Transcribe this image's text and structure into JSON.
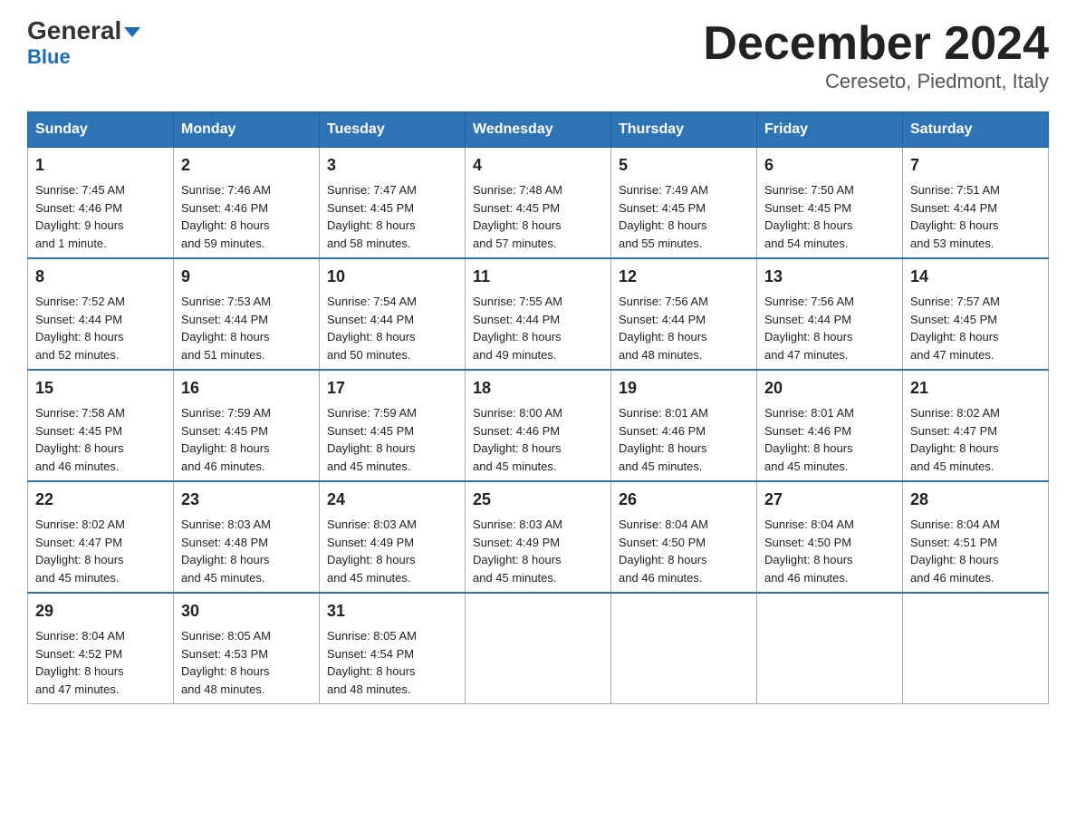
{
  "logo": {
    "general": "General",
    "blue": "Blue",
    "arrow": "▼"
  },
  "header": {
    "month_year": "December 2024",
    "location": "Cereseto, Piedmont, Italy"
  },
  "weekdays": [
    "Sunday",
    "Monday",
    "Tuesday",
    "Wednesday",
    "Thursday",
    "Friday",
    "Saturday"
  ],
  "weeks": [
    [
      {
        "day": "1",
        "sunrise": "7:45 AM",
        "sunset": "4:46 PM",
        "daylight": "9 hours and 1 minute."
      },
      {
        "day": "2",
        "sunrise": "7:46 AM",
        "sunset": "4:46 PM",
        "daylight": "8 hours and 59 minutes."
      },
      {
        "day": "3",
        "sunrise": "7:47 AM",
        "sunset": "4:45 PM",
        "daylight": "8 hours and 58 minutes."
      },
      {
        "day": "4",
        "sunrise": "7:48 AM",
        "sunset": "4:45 PM",
        "daylight": "8 hours and 57 minutes."
      },
      {
        "day": "5",
        "sunrise": "7:49 AM",
        "sunset": "4:45 PM",
        "daylight": "8 hours and 55 minutes."
      },
      {
        "day": "6",
        "sunrise": "7:50 AM",
        "sunset": "4:45 PM",
        "daylight": "8 hours and 54 minutes."
      },
      {
        "day": "7",
        "sunrise": "7:51 AM",
        "sunset": "4:44 PM",
        "daylight": "8 hours and 53 minutes."
      }
    ],
    [
      {
        "day": "8",
        "sunrise": "7:52 AM",
        "sunset": "4:44 PM",
        "daylight": "8 hours and 52 minutes."
      },
      {
        "day": "9",
        "sunrise": "7:53 AM",
        "sunset": "4:44 PM",
        "daylight": "8 hours and 51 minutes."
      },
      {
        "day": "10",
        "sunrise": "7:54 AM",
        "sunset": "4:44 PM",
        "daylight": "8 hours and 50 minutes."
      },
      {
        "day": "11",
        "sunrise": "7:55 AM",
        "sunset": "4:44 PM",
        "daylight": "8 hours and 49 minutes."
      },
      {
        "day": "12",
        "sunrise": "7:56 AM",
        "sunset": "4:44 PM",
        "daylight": "8 hours and 48 minutes."
      },
      {
        "day": "13",
        "sunrise": "7:56 AM",
        "sunset": "4:44 PM",
        "daylight": "8 hours and 47 minutes."
      },
      {
        "day": "14",
        "sunrise": "7:57 AM",
        "sunset": "4:45 PM",
        "daylight": "8 hours and 47 minutes."
      }
    ],
    [
      {
        "day": "15",
        "sunrise": "7:58 AM",
        "sunset": "4:45 PM",
        "daylight": "8 hours and 46 minutes."
      },
      {
        "day": "16",
        "sunrise": "7:59 AM",
        "sunset": "4:45 PM",
        "daylight": "8 hours and 46 minutes."
      },
      {
        "day": "17",
        "sunrise": "7:59 AM",
        "sunset": "4:45 PM",
        "daylight": "8 hours and 45 minutes."
      },
      {
        "day": "18",
        "sunrise": "8:00 AM",
        "sunset": "4:46 PM",
        "daylight": "8 hours and 45 minutes."
      },
      {
        "day": "19",
        "sunrise": "8:01 AM",
        "sunset": "4:46 PM",
        "daylight": "8 hours and 45 minutes."
      },
      {
        "day": "20",
        "sunrise": "8:01 AM",
        "sunset": "4:46 PM",
        "daylight": "8 hours and 45 minutes."
      },
      {
        "day": "21",
        "sunrise": "8:02 AM",
        "sunset": "4:47 PM",
        "daylight": "8 hours and 45 minutes."
      }
    ],
    [
      {
        "day": "22",
        "sunrise": "8:02 AM",
        "sunset": "4:47 PM",
        "daylight": "8 hours and 45 minutes."
      },
      {
        "day": "23",
        "sunrise": "8:03 AM",
        "sunset": "4:48 PM",
        "daylight": "8 hours and 45 minutes."
      },
      {
        "day": "24",
        "sunrise": "8:03 AM",
        "sunset": "4:49 PM",
        "daylight": "8 hours and 45 minutes."
      },
      {
        "day": "25",
        "sunrise": "8:03 AM",
        "sunset": "4:49 PM",
        "daylight": "8 hours and 45 minutes."
      },
      {
        "day": "26",
        "sunrise": "8:04 AM",
        "sunset": "4:50 PM",
        "daylight": "8 hours and 46 minutes."
      },
      {
        "day": "27",
        "sunrise": "8:04 AM",
        "sunset": "4:50 PM",
        "daylight": "8 hours and 46 minutes."
      },
      {
        "day": "28",
        "sunrise": "8:04 AM",
        "sunset": "4:51 PM",
        "daylight": "8 hours and 46 minutes."
      }
    ],
    [
      {
        "day": "29",
        "sunrise": "8:04 AM",
        "sunset": "4:52 PM",
        "daylight": "8 hours and 47 minutes."
      },
      {
        "day": "30",
        "sunrise": "8:05 AM",
        "sunset": "4:53 PM",
        "daylight": "8 hours and 48 minutes."
      },
      {
        "day": "31",
        "sunrise": "8:05 AM",
        "sunset": "4:54 PM",
        "daylight": "8 hours and 48 minutes."
      },
      null,
      null,
      null,
      null
    ]
  ],
  "labels": {
    "sunrise_prefix": "Sunrise: ",
    "sunset_prefix": "Sunset: ",
    "daylight_prefix": "Daylight: "
  }
}
